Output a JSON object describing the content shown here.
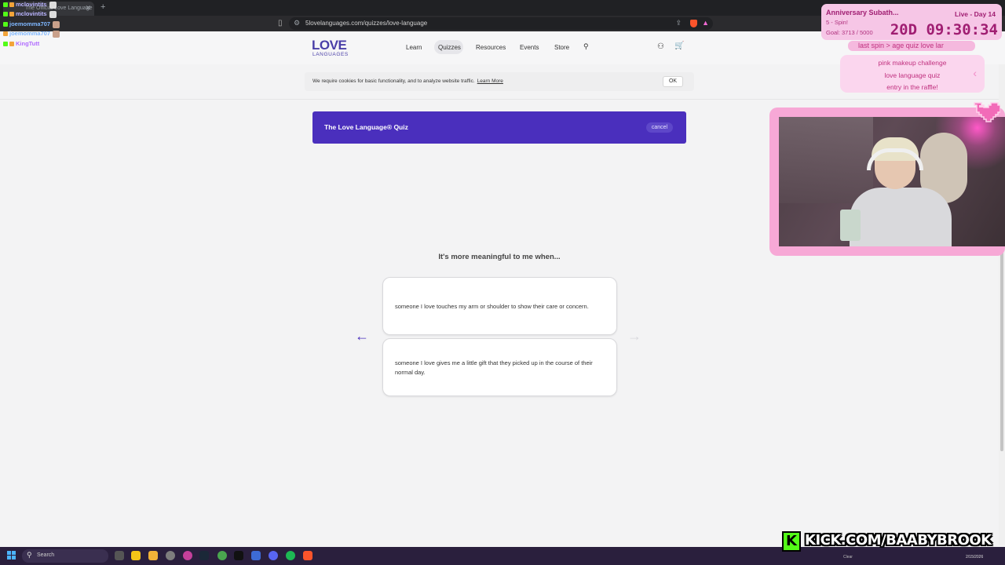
{
  "browser": {
    "tab_title": "The Official Love Language",
    "url": "5lovelanguages.com/quizzes/love-language",
    "icons": {
      "bookmark": "bookmark-icon",
      "site_info": "tune-icon",
      "share": "share-icon",
      "brave": "brave-lion-icon",
      "rewards": "triangle-icon"
    }
  },
  "site": {
    "logo_main": "LOVE",
    "logo_sub": "LANGUAGES",
    "nav": {
      "learn": "Learn",
      "quizzes": "Quizzes",
      "resources": "Resources",
      "events": "Events",
      "store": "Store"
    },
    "brand_color": "#4a2fbd"
  },
  "cookie": {
    "text": "We require cookies for basic functionality, and to analyze website traffic.",
    "learn_more": "Learn More",
    "ok": "OK"
  },
  "quiz": {
    "title": "The Love Language® Quiz",
    "cancel": "cancel",
    "question": "It's more meaningful to me when...",
    "answers": [
      "someone I love touches my arm or shoulder to show their care or concern.",
      "someone I love gives me a little gift that they picked up in the course of their normal day."
    ],
    "prev_arrow": "←",
    "next_arrow": "→"
  },
  "taskbar": {
    "search_label": "Search",
    "weather": "Clear",
    "time": "",
    "date": "2/15/2026"
  },
  "overlay": {
    "chat": [
      {
        "user": "mclovintits",
        "color": "#b9b3ff"
      },
      {
        "user": "mclovintits",
        "color": "#b9b3ff"
      },
      {
        "user": "joemomma707",
        "color": "#7fb7ff"
      },
      {
        "user": "joemomma707",
        "color": "#7fb7ff"
      },
      {
        "user": "KingTutt",
        "color": "#b06bff"
      }
    ],
    "sub_goal": {
      "title": "Anniversary Subath...",
      "live": "Live - Day 14",
      "spin": "5 - Spin!",
      "goal": "Goal: 3713 / 5000",
      "timer": "20D 09:30:34"
    },
    "ticker": "last spin  >  age quiz love lar",
    "announce": [
      "pink makeup challenge",
      "love language quiz",
      "entry in the raffle!"
    ],
    "kick_logo": "K",
    "kick_url": "KICK.COM/BAABYBROOK",
    "accent": "#f7a8d6"
  }
}
